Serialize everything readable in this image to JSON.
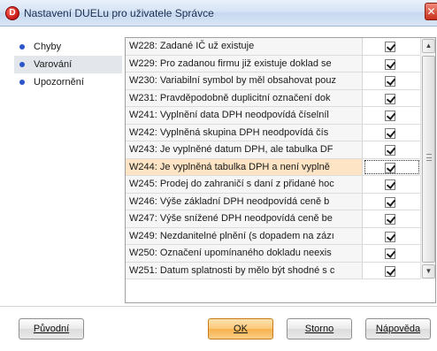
{
  "window": {
    "title": "Nastavení DUELu pro uživatele Správce",
    "app_icon_letter": "D",
    "close_glyph": "✕"
  },
  "categories": [
    {
      "label": "Chyby",
      "selected": false
    },
    {
      "label": "Varování",
      "selected": true
    },
    {
      "label": "Upozornění",
      "selected": false
    }
  ],
  "messages": [
    {
      "text": "W228: Zadané IČ už existuje",
      "checked": true
    },
    {
      "text": "W229: Pro zadanou firmu již existuje doklad se",
      "checked": true
    },
    {
      "text": "W230: Variabilní symbol by měl obsahovat pouz",
      "checked": true
    },
    {
      "text": "W231: Pravděpodobně duplicitní označení dok",
      "checked": true
    },
    {
      "text": "W241: Vyplnění data DPH neodpovídá číselníl",
      "checked": true
    },
    {
      "text": "W242: Vyplněná skupina DPH neodpovídá čís",
      "checked": true
    },
    {
      "text": "W243: Je vyplněné datum DPH, ale tabulka DF",
      "checked": true
    },
    {
      "text": "W244: Je vyplněná tabulka DPH a není vyplně",
      "checked": true,
      "selected": true
    },
    {
      "text": "W245: Prodej do zahraničí s daní z přidané hoc",
      "checked": true
    },
    {
      "text": "W246: Výše základní DPH neodpovídá ceně b",
      "checked": true
    },
    {
      "text": "W247: Výše snížené DPH neodpovídá ceně be",
      "checked": true
    },
    {
      "text": "W249: Nezdanitelné plnění (s dopadem na zázı",
      "checked": true
    },
    {
      "text": "W250: Označení upomínaného dokladu neexis",
      "checked": true
    },
    {
      "text": "W251: Datum splatnosti by mělo být shodné s c",
      "checked": true
    }
  ],
  "scrollbar": {
    "up_glyph": "▲",
    "down_glyph": "▼"
  },
  "buttons": {
    "puvodni": "Původní",
    "ok": "OK",
    "storno": "Storno",
    "napoveda": "Nápověda"
  }
}
